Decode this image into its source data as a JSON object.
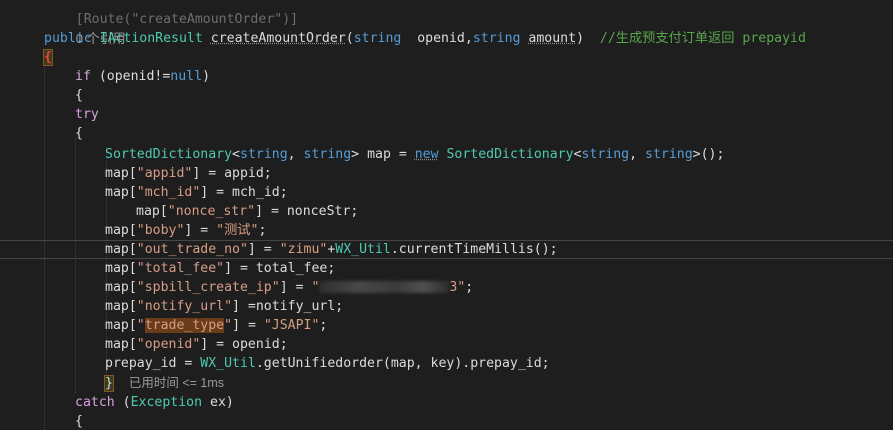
{
  "code": {
    "line0": "[Route(\"createAmountOrder\")]",
    "references": "0 个引用",
    "sig_public": "public",
    "sig_type": "IActionResult",
    "sig_method": "createAmountOrder",
    "sig_open": "(",
    "sig_string1": "string",
    "sig_p1": "openid",
    "sig_comma": ",",
    "sig_string2": "string",
    "sig_p2": "amount",
    "sig_close": ")",
    "sig_comment": "//生成预支付订单返回 prepayid",
    "brace_open": "{",
    "if_kw": "if",
    "if_cond": " (openid!=",
    "null_kw": "null",
    "if_close": ")",
    "brace_open2": "{",
    "try_kw": "try",
    "brace_open3": "{",
    "sd_type": "SortedDictionary",
    "sd_lt": "<",
    "sd_string1": "string",
    "sd_comma": ", ",
    "sd_string2": "string",
    "sd_gt": ">",
    "sd_var": " map = ",
    "sd_new": "new",
    "sd_type2": "SortedDictionary",
    "sd_lt2": "<",
    "sd_string3": "string",
    "sd_comma2": ", ",
    "sd_string4": "string",
    "sd_gt2": ">",
    "sd_end": "();",
    "l_appid_a": "map[",
    "l_appid_s": "\"appid\"",
    "l_appid_b": "] = appid;",
    "l_mch_a": "map[",
    "l_mch_s": "\"mch_id\"",
    "l_mch_b": "] = mch_id;",
    "l_nonce_a": "map[",
    "l_nonce_s": "\"nonce_str\"",
    "l_nonce_b": "] = nonceStr;",
    "l_boby_a": "map[",
    "l_boby_s": "\"boby\"",
    "l_boby_b": "] = ",
    "l_boby_v": "\"测试\"",
    "l_boby_c": ";",
    "l_otn_a": "map[",
    "l_otn_s": "\"out_trade_no\"",
    "l_otn_b": "] = ",
    "l_otn_v": "\"zimu\"",
    "l_otn_plus": "+",
    "l_otn_type": "WX_Util",
    "l_otn_c": ".currentTimeMillis();",
    "l_tf_a": "map[",
    "l_tf_s": "\"total_fee\"",
    "l_tf_b": "] = total_fee;",
    "l_ip_a": "map[",
    "l_ip_s": "\"spbill_create_ip\"",
    "l_ip_b": "] = ",
    "l_ip_q1": "\"",
    "l_ip_q2": "3\"",
    "l_ip_c": ";",
    "l_nu_a": "map[",
    "l_nu_s": "\"notify_url\"",
    "l_nu_b": "] =notify_url;",
    "l_tt_a": "map[",
    "l_tt_q1": "\"",
    "l_tt_s": "trade_type",
    "l_tt_q2": "\"",
    "l_tt_b": "] = ",
    "l_tt_v": "\"JSAPI\"",
    "l_tt_c": ";",
    "l_oid_a": "map[",
    "l_oid_s": "\"openid\"",
    "l_oid_b": "] = openid;",
    "l_pp_a": "prepay_id = ",
    "l_pp_type": "WX_Util",
    "l_pp_b": ".getUnifiedorder(map, key).prepay_id;",
    "brace_close3": "}",
    "perf_tip": "已用时间 <= 1ms",
    "catch_kw": "catch",
    "catch_open": " (",
    "catch_type": "Exception",
    "catch_rest": " ex)",
    "brace_open4": "{"
  },
  "colors": {
    "background": "#1e1e1e",
    "keyword": "#569cd6",
    "control_keyword": "#d8a0df",
    "type": "#4ec9b0",
    "string": "#d69d85",
    "comment": "#57a64a",
    "text": "#dcdcdc"
  }
}
